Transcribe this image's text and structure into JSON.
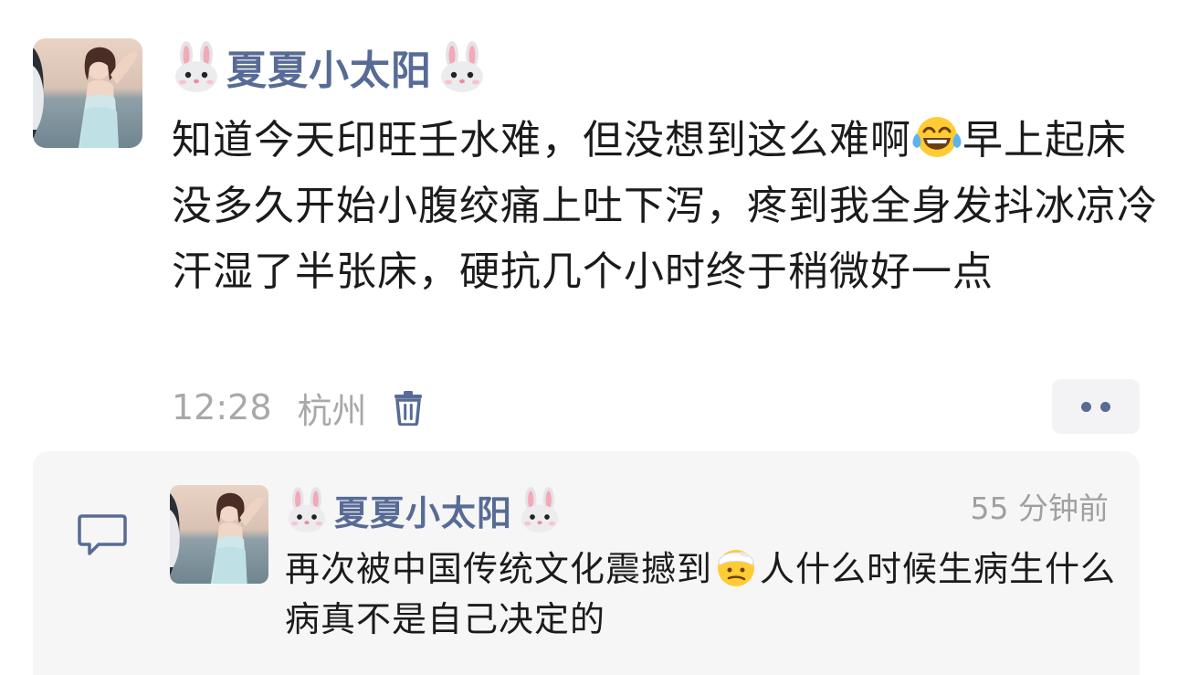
{
  "post": {
    "author": "夏夏小太阳",
    "author_prefix_emoji": "rabbit-face-emoji",
    "author_suffix_emoji": "rabbit-face-emoji",
    "text_part1": "知道今天印旺壬水难，但没想到这么难啊",
    "text_emoji": "tears-of-joy-emoji",
    "text_part2": "早上起床没多久开始小腹绞痛上吐下泻，疼到我全身发抖冰凉冷汗湿了半张床，硬抗几个小时终于稍微好一点",
    "time": "12:28",
    "location": "杭州",
    "delete_icon": "trash-icon",
    "more_icon": "two-dots-icon"
  },
  "comments": [
    {
      "author": "夏夏小太阳",
      "author_prefix_emoji": "rabbit-face-emoji",
      "author_suffix_emoji": "rabbit-face-emoji",
      "time": "55 分钟前",
      "text_part1": "再次被中国传统文化震撼到",
      "text_emoji": "head-bandage-emoji",
      "text_part2": "人什么时候生病生什么病真不是自己决定的"
    }
  ],
  "colors": {
    "link_blue": "#576b95",
    "meta_gray": "#a8a8a8",
    "text": "#1b1b1b",
    "comment_bg": "#f6f6f7"
  }
}
